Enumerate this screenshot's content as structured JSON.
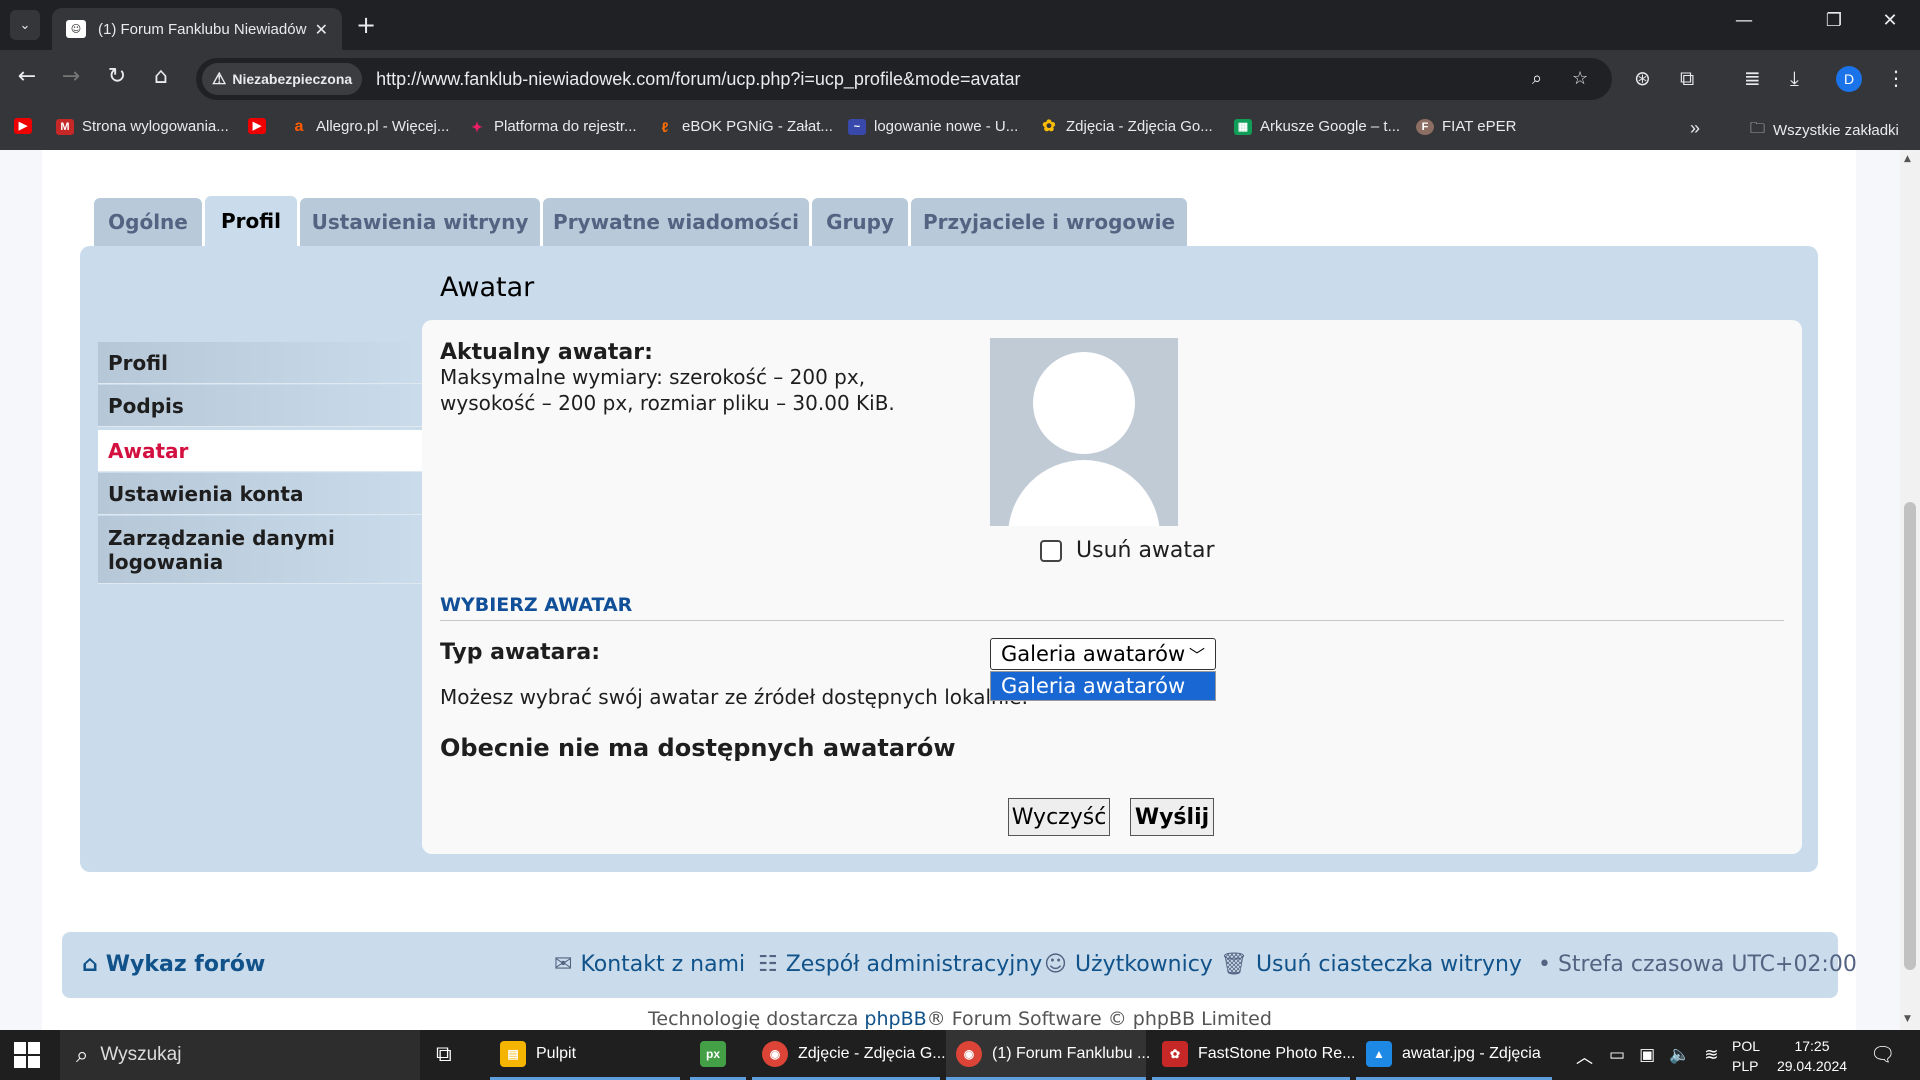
{
  "browser": {
    "tab_title": "(1) Forum Fanklubu Niewiadów",
    "security_label": "Niezabezpieczona",
    "url": "http://www.fanklub-niewiadowek.com/forum/ucp.php?i=ucp_profile&mode=avatar",
    "profile_initial": "D",
    "bookmarks": [
      "Strona wylogowania...",
      "Allegro.pl - Więcej...",
      "Platforma do rejestr...",
      "eBOK PGNiG - Załat...",
      "logowanie nowe - U...",
      "Zdjęcia - Zdjęcia Go...",
      "Arkusze Google – t...",
      "FIAT ePER"
    ],
    "all_bookmarks_label": "Wszystkie zakładki"
  },
  "ucp": {
    "tabs": [
      "Ogólne",
      "Profil",
      "Ustawienia witryny",
      "Prywatne wiadomości",
      "Grupy",
      "Przyjaciele i wrogowie"
    ],
    "active_tab": "Profil",
    "side_menu": [
      "Profil",
      "Podpis",
      "Awatar",
      "Ustawienia konta",
      "Zarządzanie danymi logowania"
    ],
    "active_side_item": "Awatar",
    "page_title": "Awatar",
    "current_avatar_label": "Aktualny awatar:",
    "max_dimensions": "Maksymalne wymiary: szerokość – 200 px, wysokość – 200 px, rozmiar pliku – 30.00 KiB.",
    "delete_avatar_label": "Usuń awatar",
    "delete_avatar_checked": false,
    "choose_heading": "WYBIERZ AWATAR",
    "avatar_type_label": "Typ awatara:",
    "avatar_type_selected": "Galeria awatarów",
    "avatar_type_options": [
      "Galeria awatarów"
    ],
    "local_description": "Możesz wybrać swój awatar ze źródeł dostępnych lokalnie.",
    "no_avatars_message": "Obecnie nie ma dostępnych awatarów",
    "reset_button": "Wyczyść",
    "submit_button": "Wyślij"
  },
  "footer": {
    "forum_index": "Wykaz forów",
    "contact": "Kontakt z nami",
    "team": "Zespół administracyjny",
    "members": "Użytkownicy",
    "delete_cookies": "Usuń ciasteczka witryny",
    "timezone": "• Strefa czasowa UTC+02:00",
    "copyright_prefix": "Technologię dostarcza",
    "copyright_link": "phpBB",
    "copyright_suffix": "® Forum Software © phpBB Limited"
  },
  "taskbar": {
    "search_placeholder": "Wyszukaj",
    "items": [
      "Pulpit",
      "Zdjęcie - Zdjęcia G...",
      "(1) Forum Fanklubu ...",
      "FastStone Photo Re...",
      "awatar.jpg - Zdjęcia"
    ],
    "lang_top": "POL",
    "lang_bottom": "PLP",
    "time": "17:25",
    "date": "29.04.2024"
  }
}
